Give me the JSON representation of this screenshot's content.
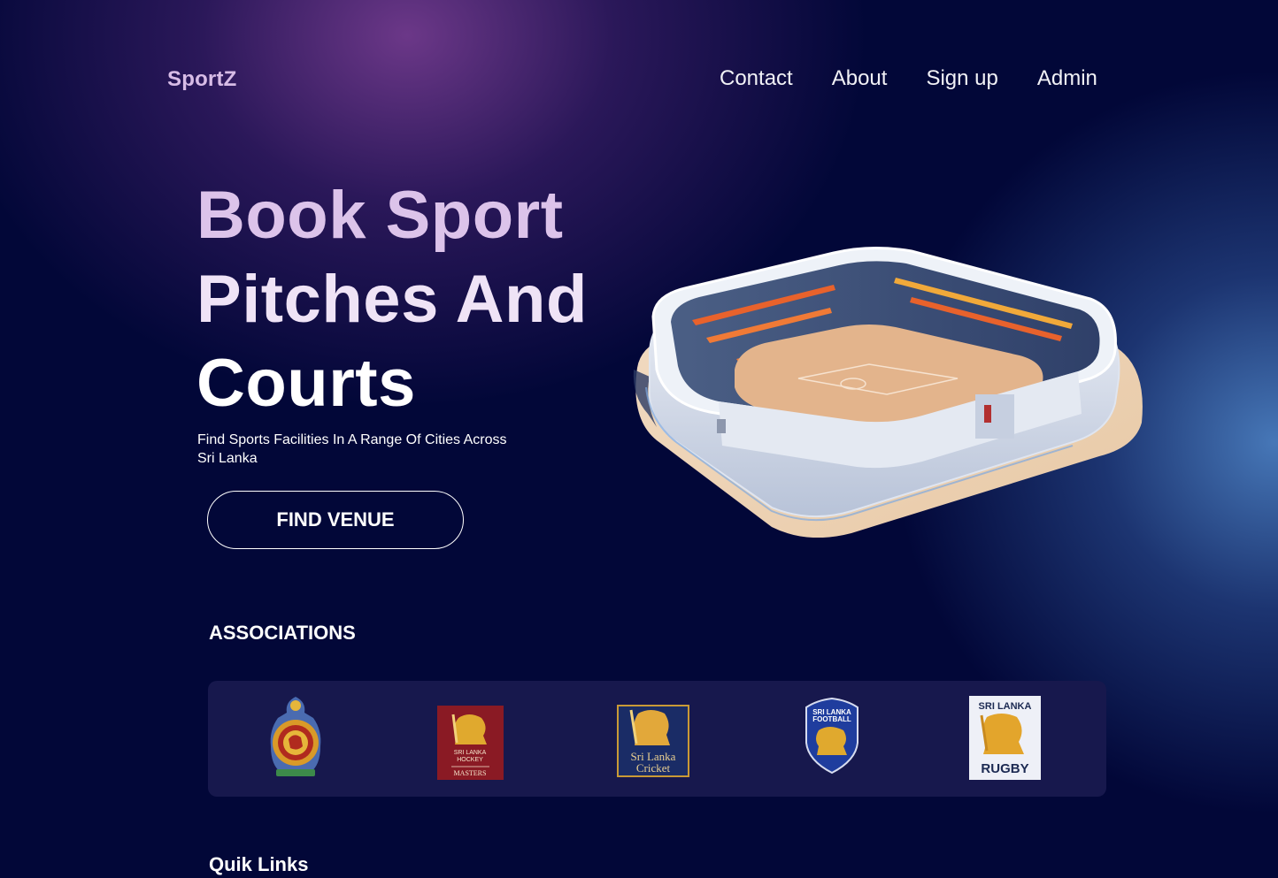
{
  "brand": "SportZ",
  "nav": {
    "contact": "Contact",
    "about": "About",
    "signup": "Sign up",
    "admin": "Admin"
  },
  "hero": {
    "line1": "Book Sport",
    "line2": "Pitches And",
    "line3": "Courts",
    "subtitle": "Find Sports Facilities In A Range Of Cities Across Sri Lanka",
    "cta": "FIND VENUE"
  },
  "associations": {
    "title": "ASSOCIATIONS",
    "logos": [
      {
        "icon": "national-emblem-icon"
      },
      {
        "icon": "hockey-lion-icon",
        "lines": [
          "SRI LANKA",
          "HOCKEY",
          "MASTERS"
        ]
      },
      {
        "icon": "cricket-lion-icon",
        "lines": [
          "Sri Lanka",
          "Cricket"
        ]
      },
      {
        "icon": "football-shield-icon",
        "lines": [
          "SRI LANKA",
          "FOOTBALL"
        ]
      },
      {
        "icon": "rugby-lion-icon",
        "lines": [
          "SRI LANKA",
          "RUGBY"
        ]
      }
    ]
  },
  "quick_links": {
    "title": "Quik Links"
  },
  "colors": {
    "background": "#020738",
    "brand": "#d7bce6",
    "panel": "#17184d",
    "glow_purple": "#7e4096",
    "glow_blue": "#4a7dbe"
  }
}
